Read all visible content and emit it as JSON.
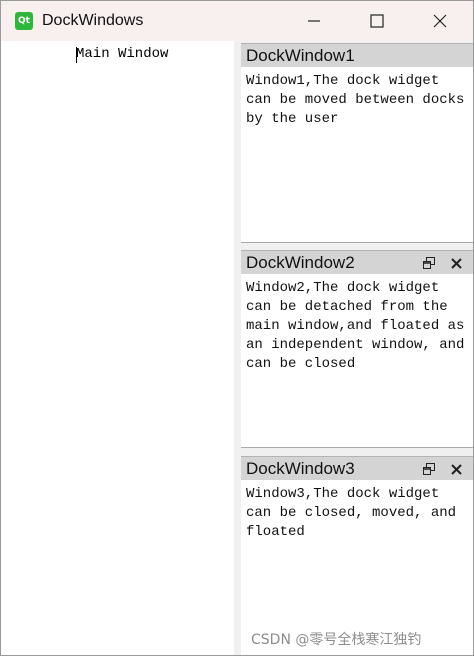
{
  "window": {
    "title": "DockWindows",
    "app_icon_text": "Qt"
  },
  "central": {
    "text": "Main Window"
  },
  "docks": [
    {
      "title": "DockWindow1",
      "text": "Window1,The dock widget can be moved between docks by the user",
      "has_buttons": false
    },
    {
      "title": "DockWindow2",
      "text": "Window2,The dock widget can be detached from the main window,and floated as an independent window, and can be closed",
      "has_buttons": true
    },
    {
      "title": "DockWindow3",
      "text": "Window3,The dock widget can be closed, moved, and floated",
      "has_buttons": true
    }
  ],
  "watermark": "CSDN @零号全栈寒江独钓",
  "colors": {
    "titlebar_bg": "#f8efef",
    "dock_title_bg": "#d4d4d4",
    "client_bg": "#f0f0f0",
    "qt_green": "#2db83d"
  }
}
